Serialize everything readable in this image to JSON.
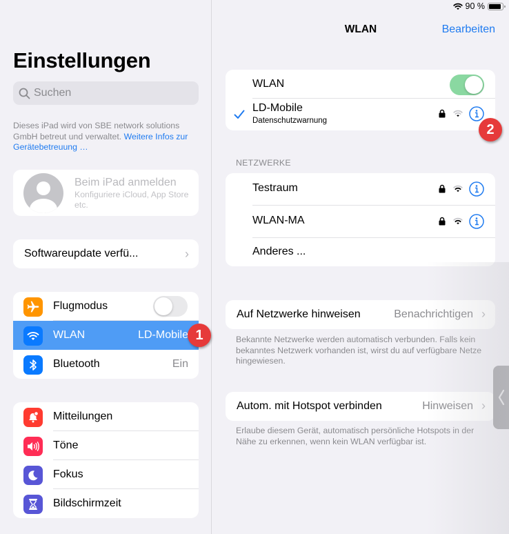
{
  "status_bar": {
    "battery_text": "90 %",
    "battery_level": 0.9,
    "icons": [
      "wifi-icon",
      "battery-icon"
    ]
  },
  "sidebar": {
    "title": "Einstellungen",
    "search": {
      "placeholder": "Suchen",
      "value": ""
    },
    "managed_notice": {
      "text": "Dieses iPad wird von SBE network solutions GmbH betreut und verwaltet. ",
      "link": "Weitere Infos zur Gerätebetreuung …"
    },
    "profile": {
      "title": "Beim iPad anmelden",
      "subtitle": "Konfiguriere iCloud, App Store etc."
    },
    "software_update": {
      "label": "Softwareupdate verfü..."
    },
    "group1": [
      {
        "label": "Flugmodus",
        "icon": "airplane-icon",
        "color": "#ff9500",
        "toggle": false
      },
      {
        "label": "WLAN",
        "icon": "wifi-icon",
        "color": "#0a7aff",
        "value": "LD-Mobile",
        "selected": true
      },
      {
        "label": "Bluetooth",
        "icon": "bluetooth-icon",
        "color": "#0a7aff",
        "value": "Ein"
      }
    ],
    "group2": [
      {
        "label": "Mitteilungen",
        "icon": "notifications-icon",
        "color": "#ff3b30"
      },
      {
        "label": "Töne",
        "icon": "sounds-icon",
        "color": "#ff2d55"
      },
      {
        "label": "Fokus",
        "icon": "moon-icon",
        "color": "#5856d6"
      },
      {
        "label": "Bildschirmzeit",
        "icon": "hourglass-icon",
        "color": "#5856d6"
      }
    ]
  },
  "main": {
    "nav_title": "WLAN",
    "edit_label": "Bearbeiten",
    "wlan_toggle": {
      "label": "WLAN",
      "on": true
    },
    "connected": {
      "name": "LD-Mobile",
      "subtitle": "Datenschutzwarnung",
      "secured": true
    },
    "networks_header": "NETZWERKE",
    "networks": [
      {
        "name": "Testraum",
        "secured": true
      },
      {
        "name": "WLAN-MA",
        "secured": true
      }
    ],
    "other_label": "Anderes ...",
    "ask_join": {
      "label": "Auf Netzwerke hinweisen",
      "value": "Benachrichtigen",
      "note": "Bekannte Netzwerke werden automatisch verbunden. Falls kein bekanntes Netzwerk vorhanden ist, wirst du auf verfügbare Netze hingewiesen."
    },
    "auto_hotspot": {
      "label": "Autom. mit Hotspot verbinden",
      "value": "Hinweisen",
      "note": "Erlaube diesem Gerät, automatisch persönliche Hotspots in der Nähe zu erkennen, wenn kein WLAN verfügbar ist."
    }
  },
  "annotations": {
    "badge1": "1",
    "badge2": "2"
  }
}
